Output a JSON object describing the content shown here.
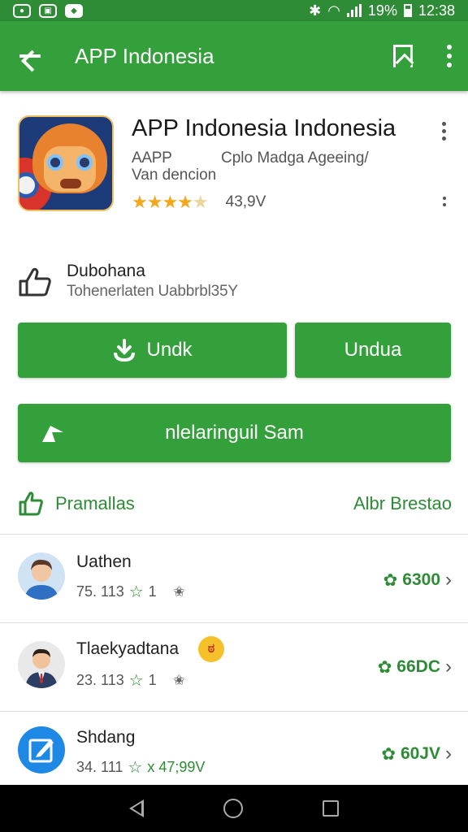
{
  "status_bar": {
    "battery": "19%",
    "time": "12:38"
  },
  "app_bar": {
    "title": "APP Indonesia"
  },
  "app": {
    "title": "APP Indonesia Indonesia",
    "developer": "AAPP",
    "developer_extra": "Cplo Madga Ageeing/",
    "category": "Van dencion",
    "rating_count": "43,9V",
    "rating": 4.5
  },
  "info": {
    "title": "Dubohana",
    "subtitle": "Tohenerlaten Uabbrbl35Y"
  },
  "buttons": {
    "install": "Undk",
    "download": "Undua",
    "share": "nlelaringuil Sam"
  },
  "section": {
    "title": "Pramallas",
    "link": "Albr Brestao"
  },
  "list": [
    {
      "name": "Uathen",
      "meta_num": "75. 113",
      "star_count": "1",
      "meta_extra": "",
      "action": "6300",
      "avatar": "man-avatar"
    },
    {
      "name": "Tlaekyadtana",
      "meta_num": "23. 113",
      "star_count": "1",
      "meta_extra": "",
      "action": "66DC",
      "avatar": "businessman-avatar"
    },
    {
      "name": "Shdang",
      "meta_num": "34. 111",
      "star_count": "",
      "meta_extra": "x 47;99V",
      "action": "60JV",
      "avatar": "edit-icon-avatar"
    }
  ],
  "colors": {
    "primary": "#34a03c",
    "status": "#2e8b36",
    "star": "#f3a71c"
  }
}
